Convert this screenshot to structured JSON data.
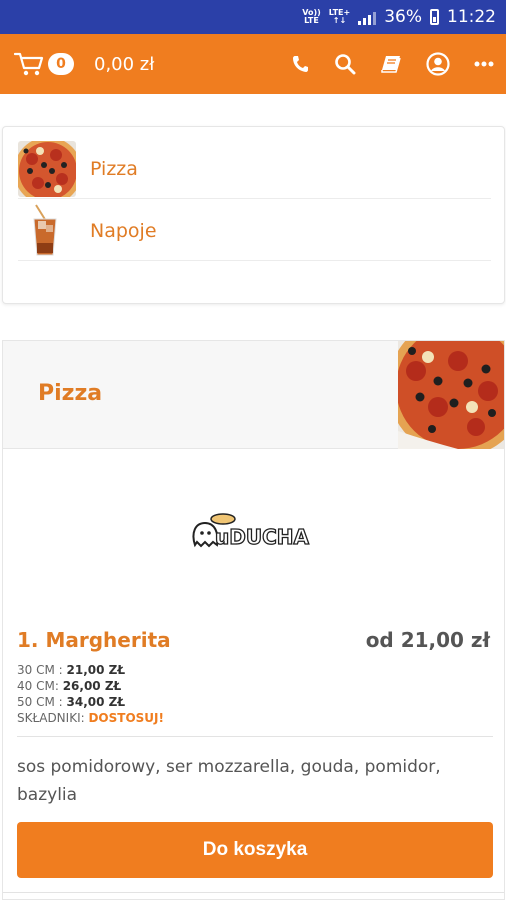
{
  "status_bar": {
    "volte_top": "Vo))",
    "volte_bottom": "LTE",
    "lte_top": "LTE+",
    "lte_bottom": "↑↓",
    "battery": "36%",
    "time": "11:22"
  },
  "header": {
    "cart_count": "0",
    "cart_total": "0,00 zł",
    "icons": [
      "phone-icon",
      "search-icon",
      "book-icon",
      "account-icon",
      "more-icon"
    ],
    "accent_color": "#f07d1f"
  },
  "categories": [
    {
      "label": "Pizza",
      "icon": "pizza-thumbnail"
    },
    {
      "label": "Napoje",
      "icon": "drink-thumbnail"
    }
  ],
  "section": {
    "title": "Pizza"
  },
  "logo_text": "uDUCHA",
  "product": {
    "name": "1. Margherita",
    "price": "od 21,00 zł",
    "sizes": [
      {
        "label": "30 CM : ",
        "price": "21,00 ZŁ"
      },
      {
        "label": "40 CM: ",
        "price": "26,00 ZŁ"
      },
      {
        "label": "50 CM : ",
        "price": "34,00 ZŁ"
      }
    ],
    "ingredients_label": "SKŁADNIKI: ",
    "customize_label": "DOSTOSUJ!",
    "description": "sos pomidorowy, ser mozzarella, gouda,  pomidor, bazylia",
    "add_button": "Do koszyka"
  }
}
